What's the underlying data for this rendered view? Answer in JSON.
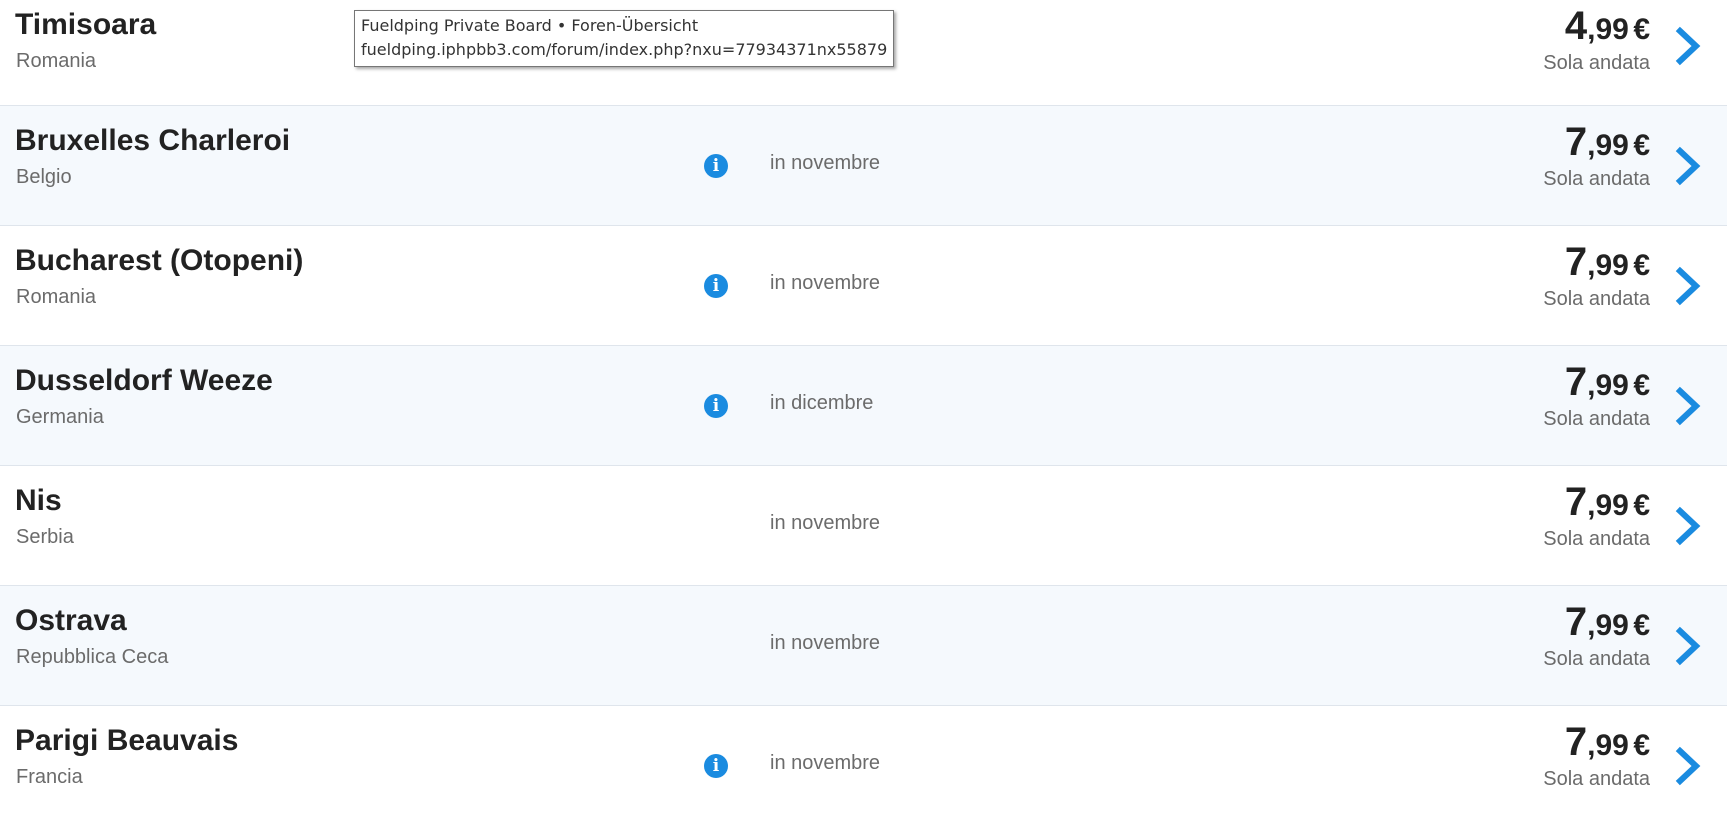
{
  "tooltip": {
    "title": "Fueldping Private Board • Foren-Übersicht",
    "url": "fueldping.iphpbb3.com/forum/index.php?nxu=77934371nx55879"
  },
  "colors": {
    "accent": "#1a8be0",
    "row_alt_bg": "#f5f9fd",
    "text_primary": "#222222",
    "text_secondary": "#6b6b6b"
  },
  "icons": {
    "info": "info-icon",
    "chevron": "chevron-right-icon"
  },
  "destinations": [
    {
      "city": "Timisoara",
      "country": "Romania",
      "info": "",
      "when": "",
      "price_int": "4",
      "price_dec": ",99",
      "currency": "€",
      "trip_type": "Sola andata"
    },
    {
      "city": "Bruxelles Charleroi",
      "country": "Belgio",
      "info": "i",
      "when": "in novembre",
      "price_int": "7",
      "price_dec": ",99",
      "currency": "€",
      "trip_type": "Sola andata"
    },
    {
      "city": "Bucharest (Otopeni)",
      "country": "Romania",
      "info": "i",
      "when": "in novembre",
      "price_int": "7",
      "price_dec": ",99",
      "currency": "€",
      "trip_type": "Sola andata"
    },
    {
      "city": "Dusseldorf Weeze",
      "country": "Germania",
      "info": "i",
      "when": "in dicembre",
      "price_int": "7",
      "price_dec": ",99",
      "currency": "€",
      "trip_type": "Sola andata"
    },
    {
      "city": "Nis",
      "country": "Serbia",
      "info": "",
      "when": "in novembre",
      "price_int": "7",
      "price_dec": ",99",
      "currency": "€",
      "trip_type": "Sola andata"
    },
    {
      "city": "Ostrava",
      "country": "Repubblica Ceca",
      "info": "",
      "when": "in novembre",
      "price_int": "7",
      "price_dec": ",99",
      "currency": "€",
      "trip_type": "Sola andata"
    },
    {
      "city": "Parigi Beauvais",
      "country": "Francia",
      "info": "i",
      "when": "in novembre",
      "price_int": "7",
      "price_dec": ",99",
      "currency": "€",
      "trip_type": "Sola andata"
    }
  ]
}
